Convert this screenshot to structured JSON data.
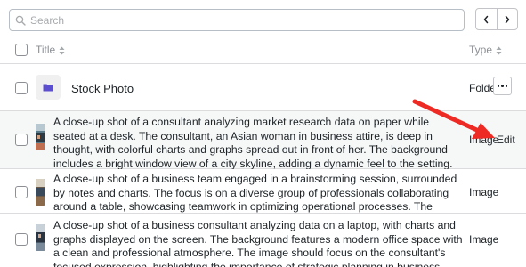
{
  "search": {
    "placeholder": "Search"
  },
  "header": {
    "title_label": "Title",
    "type_label": "Type"
  },
  "folder_row": {
    "title": "Stock Photo",
    "type": "Folder"
  },
  "rows": [
    {
      "description": "A close-up shot of a consultant analyzing market research data on paper while seated at a desk. The consultant, an Asian woman in business attire, is deep in thought, with colorful charts and graphs spread out in front of her. The background includes a bright window view of a city skyline, adding a dynamic feel to the setting. The image captures the essence of analytical thinking and data-driven decision-making, showcasing the consultant's expertise.",
      "type": "Image",
      "action": "Edit"
    },
    {
      "description": "A close-up shot of a business team engaged in a brainstorming session, surrounded by notes and charts. The focus is on a diverse group of professionals collaborating around a table, showcasing teamwork in optimizing operational processes. The background reflects a vibrant office environment, emphasizing creativity and productivity.",
      "type": "Image"
    },
    {
      "description": "A close-up shot of a business consultant analyzing data on a laptop, with charts and graphs displayed on the screen. The background features a modern office space with a clean and professional atmosphere. The image should focus on the consultant's focused expression, highlighting the importance of strategic planning in business.",
      "type": "Image"
    }
  ],
  "colors": {
    "annotation_arrow": "#ee2a24",
    "folder_icon": "#5b4fd0",
    "hover_row": "#f6f7f7"
  },
  "icons": {
    "search": "search-icon",
    "prev": "chevron-left-icon",
    "next": "chevron-right-icon",
    "folder": "folder-icon",
    "more": "more-horizontal-icon",
    "sort": "sort-icon"
  }
}
